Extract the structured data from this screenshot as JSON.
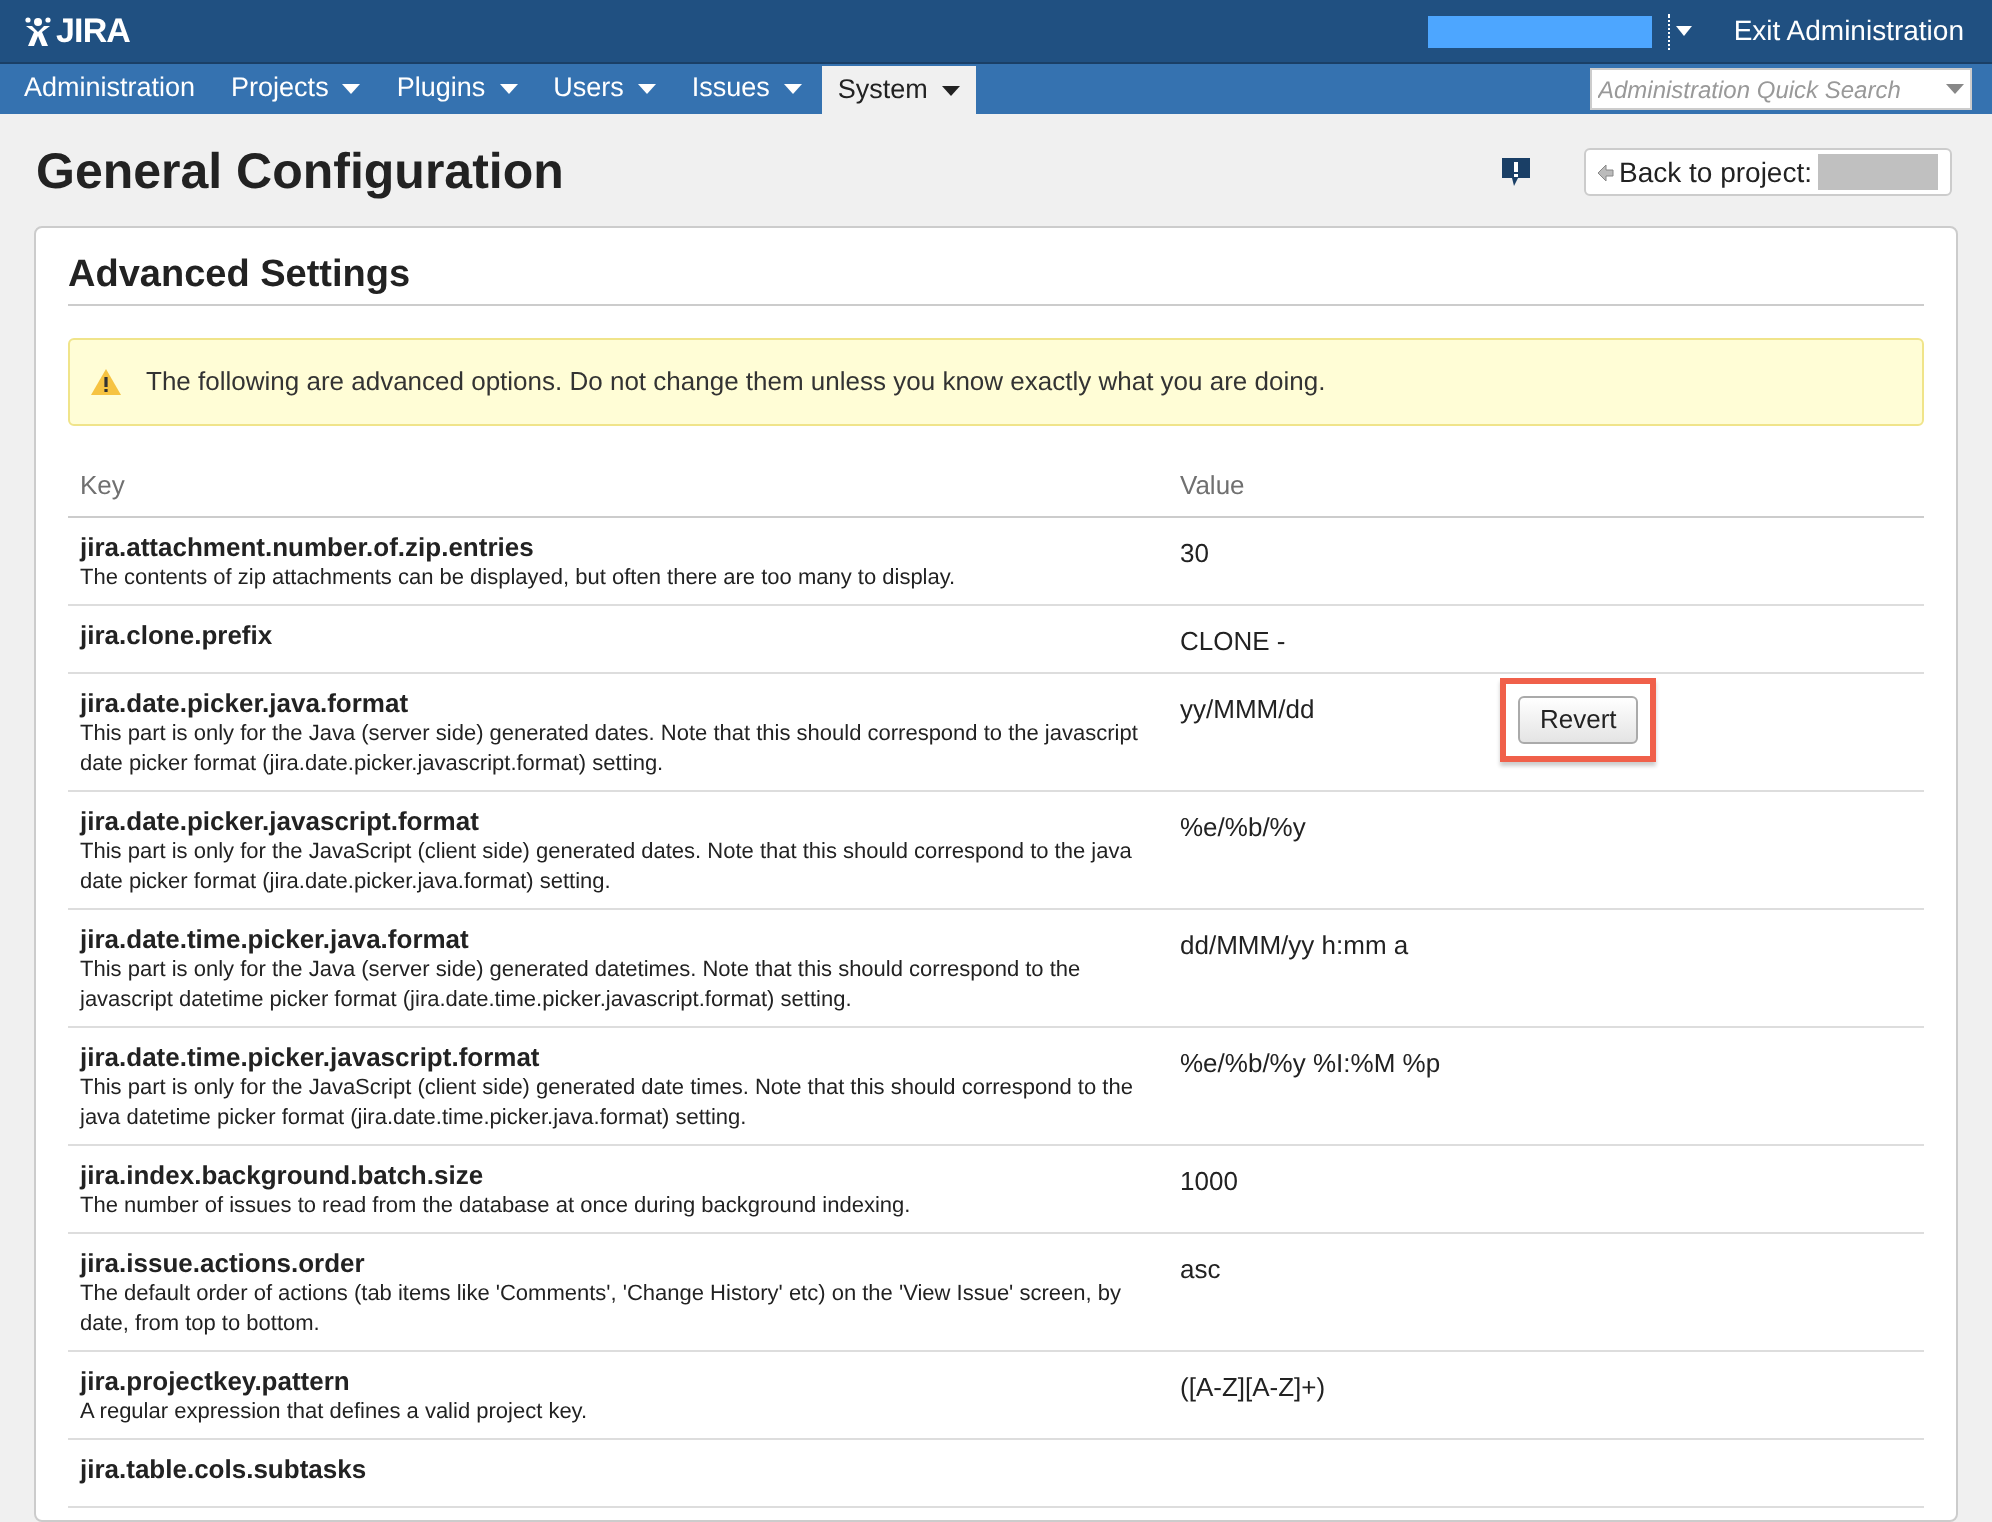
{
  "header": {
    "logo": "JIRA",
    "exit": "Exit Administration"
  },
  "nav": {
    "items": [
      {
        "label": "Administration",
        "selected": false
      },
      {
        "label": "Projects",
        "dropdown": true,
        "selected": false
      },
      {
        "label": "Plugins",
        "dropdown": true,
        "selected": false
      },
      {
        "label": "Users",
        "dropdown": true,
        "selected": false
      },
      {
        "label": "Issues",
        "dropdown": true,
        "selected": false
      },
      {
        "label": "System",
        "dropdown": true,
        "selected": true
      }
    ],
    "search": {
      "placeholder": "Administration Quick Search"
    }
  },
  "page": {
    "title": "General Configuration",
    "back": "Back to project:"
  },
  "panel": {
    "title": "Advanced Settings",
    "warning": "The following are advanced options. Do not change them unless you know exactly what you are doing.",
    "columns": [
      "Key",
      "Value"
    ],
    "rows": [
      {
        "key": "jira.attachment.number.of.zip.entries",
        "description": "The contents of zip attachments can be displayed, but often there are too many to display.",
        "value": "30"
      },
      {
        "key": "jira.clone.prefix",
        "value": "CLONE -"
      },
      {
        "key": "jira.date.picker.java.format",
        "description": "This part is only for the Java (server side) generated dates. Note that this should correspond to the javascript date picker format (jira.date.picker.javascript.format) setting.",
        "value": "yy/MMM/dd",
        "action": "Revert"
      },
      {
        "key": "jira.date.picker.javascript.format",
        "description": "This part is only for the JavaScript (client side) generated dates. Note that this should correspond to the java date picker format (jira.date.picker.java.format) setting.",
        "value": "%e/%b/%y"
      },
      {
        "key": "jira.date.time.picker.java.format",
        "description": "This part is only for the Java (server side) generated datetimes. Note that this should correspond to the javascript datetime picker format (jira.date.time.picker.javascript.format) setting.",
        "value": "dd/MMM/yy h:mm a"
      },
      {
        "key": "jira.date.time.picker.javascript.format",
        "description": "This part is only for the JavaScript (client side) generated date times. Note that this should correspond to the java datetime picker format (jira.date.time.picker.java.format) setting.",
        "value": "%e/%b/%y %I:%M %p"
      },
      {
        "key": "jira.index.background.batch.size",
        "description": "The number of issues to read from the database at once during background indexing.",
        "value": "1000"
      },
      {
        "key": "jira.issue.actions.order",
        "description": "The default order of actions (tab items like 'Comments', 'Change History' etc) on the 'View Issue' screen, by date, from top to bottom.",
        "value": "asc"
      },
      {
        "key": "jira.projectkey.pattern",
        "description": "A regular expression that defines a valid project key.",
        "value": "([A-Z][A-Z]+)"
      },
      {
        "key": "jira.table.cols.subtasks"
      }
    ]
  }
}
